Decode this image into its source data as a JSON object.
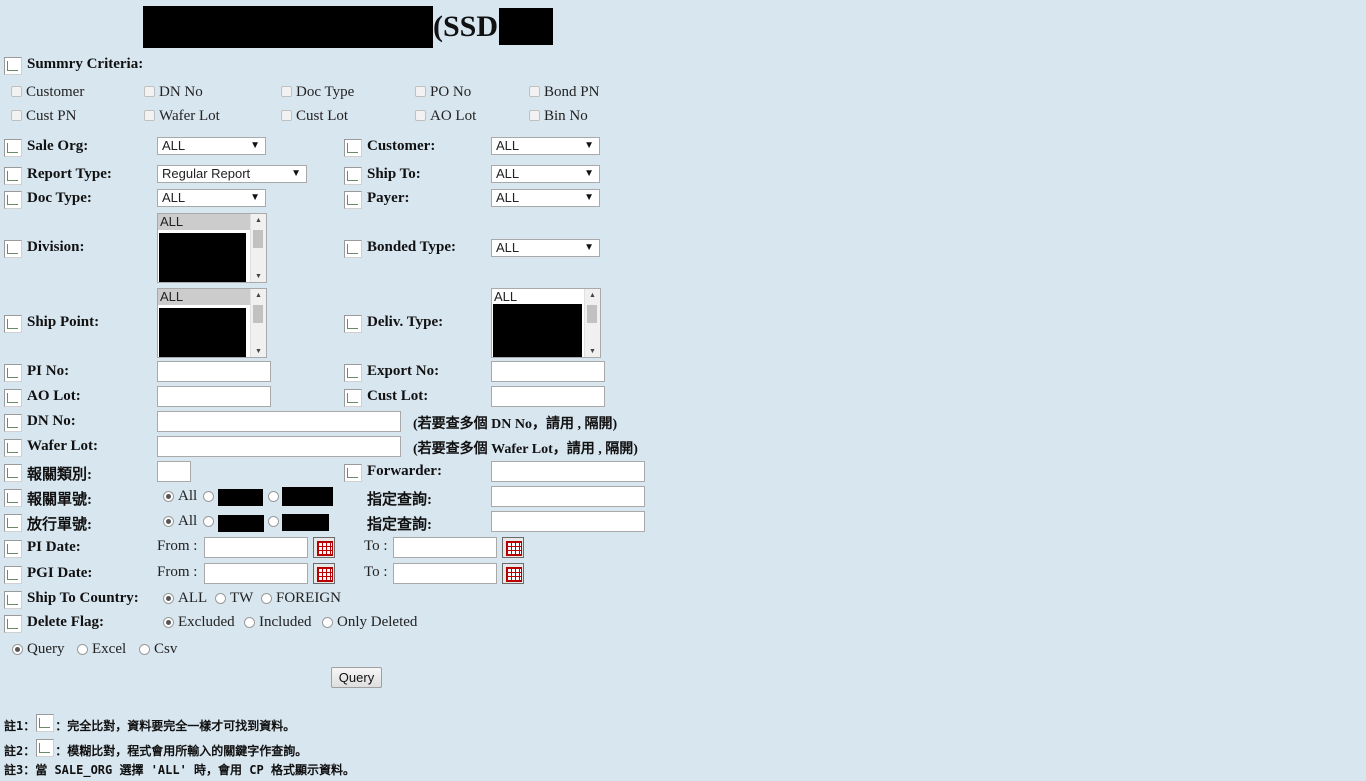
{
  "header": {
    "title": "(SSD)"
  },
  "summary": {
    "label": "Summry Criteria:",
    "checkboxes": [
      "Customer",
      "DN No",
      "Doc Type",
      "PO No",
      "Bond PN",
      "Cust PN",
      "Wafer Lot",
      "Cust Lot",
      "AO Lot",
      "Bin No"
    ]
  },
  "fields": {
    "sale_org": {
      "label": "Sale Org:",
      "value": "ALL"
    },
    "customer": {
      "label": "Customer:",
      "value": "ALL"
    },
    "report_type": {
      "label": "Report Type:",
      "value": "Regular Report"
    },
    "ship_to": {
      "label": "Ship To:",
      "value": "ALL"
    },
    "doc_type": {
      "label": "Doc Type:",
      "value": "ALL"
    },
    "payer": {
      "label": "Payer:",
      "value": "ALL"
    },
    "division": {
      "label": "Division:",
      "value": "ALL"
    },
    "bonded_type": {
      "label": "Bonded Type:",
      "value": "ALL"
    },
    "ship_point": {
      "label": "Ship Point:",
      "value": "ALL"
    },
    "deliv_type": {
      "label": "Deliv. Type:",
      "value": "ALL"
    },
    "pi_no": {
      "label": "PI No:"
    },
    "export_no": {
      "label": "Export No:"
    },
    "ao_lot": {
      "label": "AO Lot:"
    },
    "cust_lot": {
      "label": "Cust Lot:"
    },
    "dn_no": {
      "label": "DN No:",
      "hint": "(若要查多個 DN No，請用 , 隔開)"
    },
    "wafer_lot": {
      "label": "Wafer Lot:",
      "hint": "(若要查多個 Wafer Lot，請用 , 隔開)"
    },
    "customs_category": {
      "label": "報關類別:"
    },
    "forwarder": {
      "label": "Forwarder:"
    },
    "customs_no": {
      "label": "報關單號:",
      "all": "All",
      "specify": "指定查詢:"
    },
    "release_no": {
      "label": "放行單號:",
      "all": "All",
      "specify": "指定查詢:"
    },
    "pi_date": {
      "label": "PI Date:",
      "from": "From :",
      "to": "To :"
    },
    "pgi_date": {
      "label": "PGI Date:",
      "from": "From :",
      "to": "To :"
    },
    "ship_to_country": {
      "label": "Ship To Country:",
      "options": [
        "ALL",
        "TW",
        "FOREIGN"
      ],
      "selected": "ALL"
    },
    "delete_flag": {
      "label": "Delete Flag:",
      "options": [
        "Excluded",
        "Included",
        "Only Deleted"
      ],
      "selected": "Excluded"
    }
  },
  "output": {
    "options": [
      "Query",
      "Excel",
      "Csv"
    ],
    "selected": "Query"
  },
  "query_button": "Query",
  "notes": {
    "n1_prefix": "註1：",
    "n1_text": "：完全比對，資料要完全一樣才可找到資料。",
    "n2_prefix": "註2：",
    "n2_text": "：模糊比對，程式會用所輸入的關鍵字作查詢。",
    "n3": "註3：當 SALE_ORG 選擇 'ALL' 時，會用 CP 格式顯示資料。"
  },
  "icons": {
    "criteria": "broken-image-icon",
    "calendar": "calendar-icon"
  }
}
